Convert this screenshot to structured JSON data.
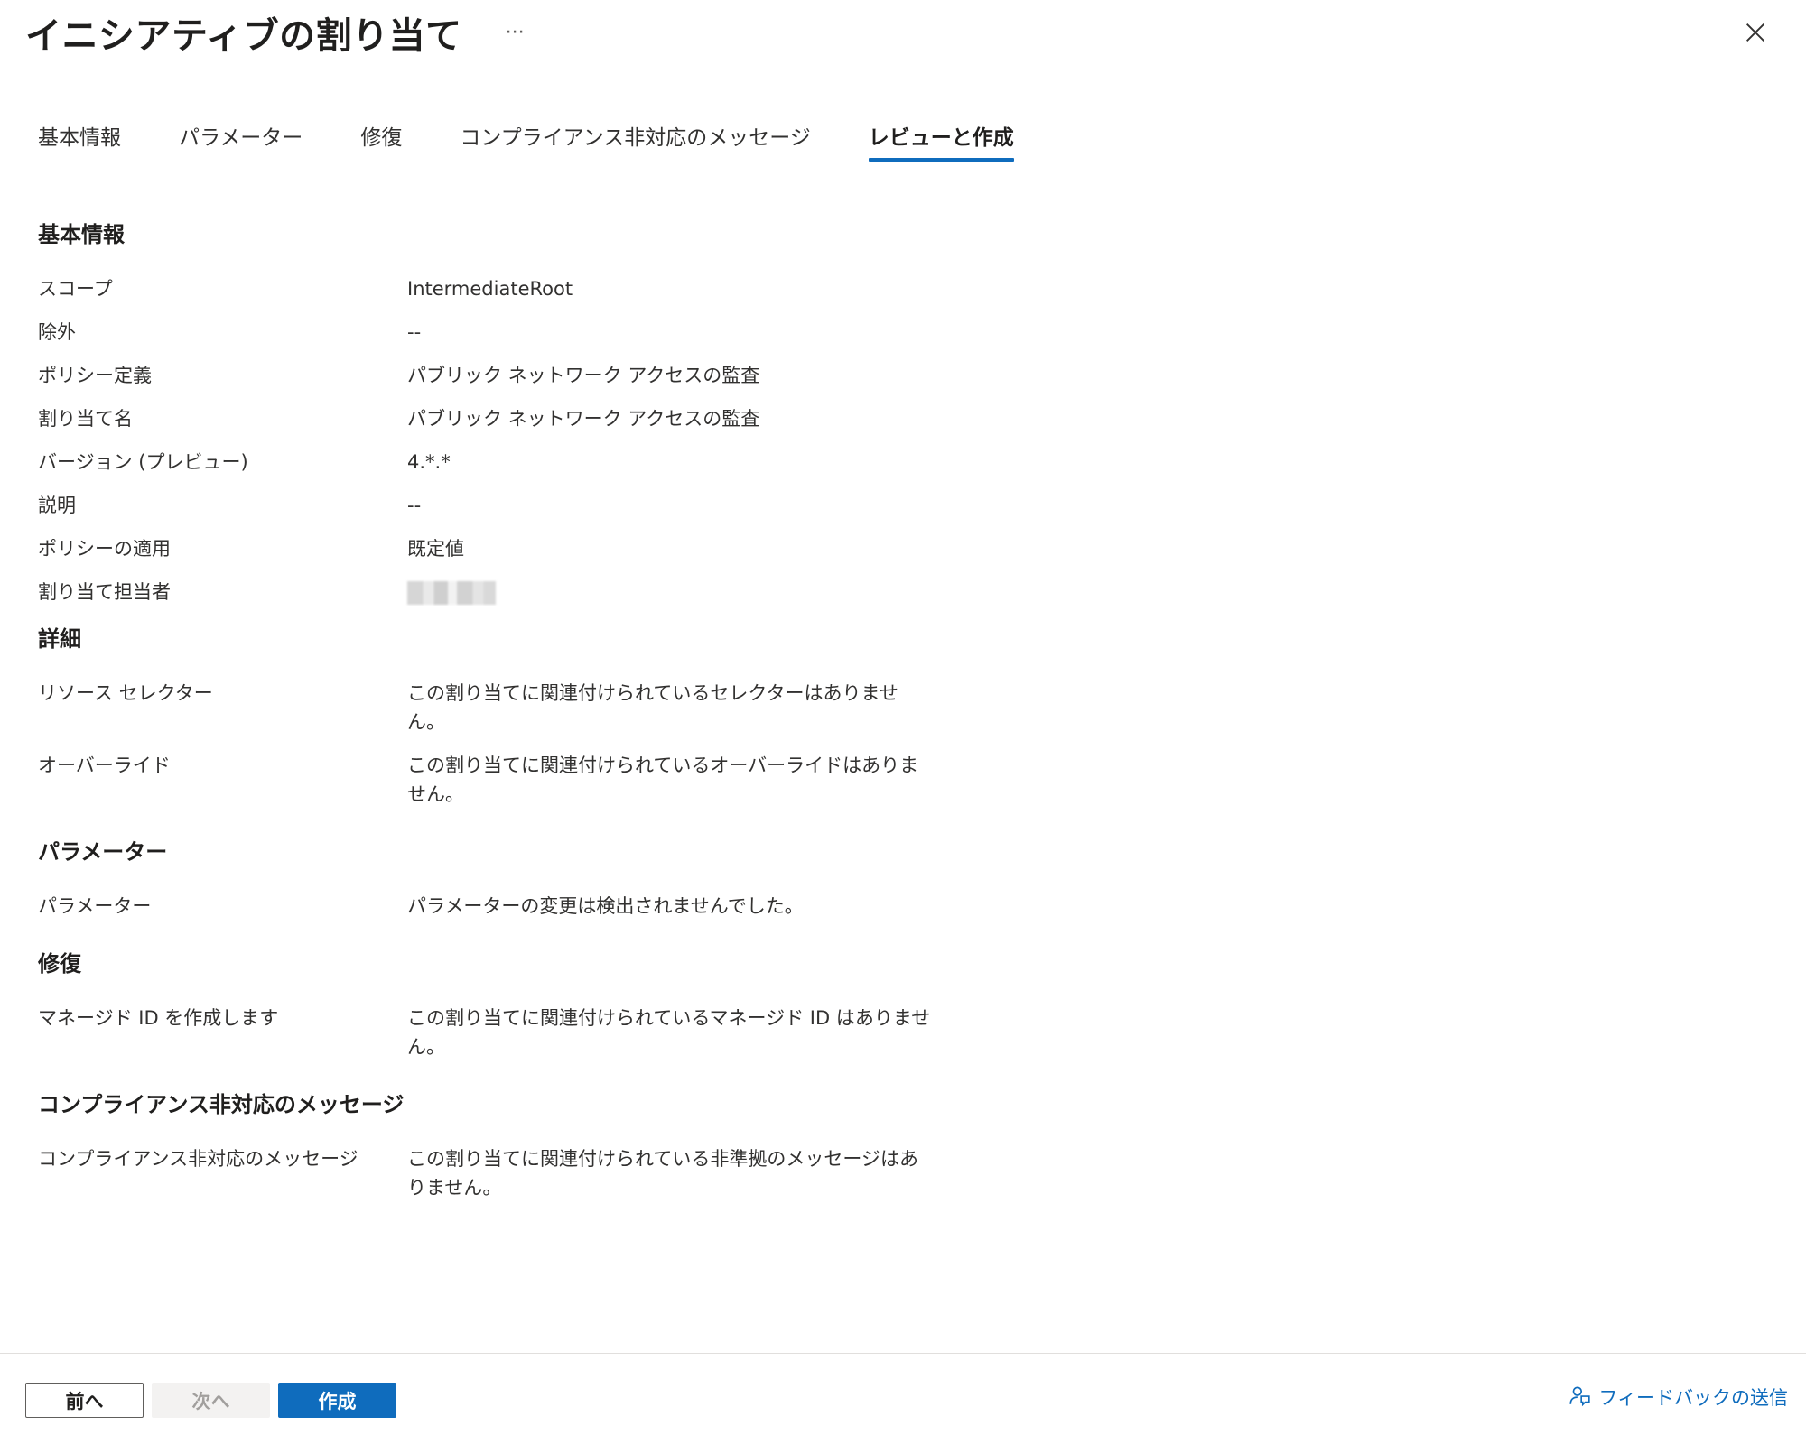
{
  "header": {
    "title": "イニシアティブの割り当て",
    "more_label": "···"
  },
  "tabs": [
    {
      "label": "基本情報",
      "active": false
    },
    {
      "label": "パラメーター",
      "active": false
    },
    {
      "label": "修復",
      "active": false
    },
    {
      "label": "コンプライアンス非対応のメッセージ",
      "active": false
    },
    {
      "label": "レビューと作成",
      "active": true
    }
  ],
  "sections": {
    "basics": {
      "title": "基本情報",
      "rows": [
        {
          "label": "スコープ",
          "value": "IntermediateRoot"
        },
        {
          "label": "除外",
          "value": "--"
        },
        {
          "label": "ポリシー定義",
          "value": "パブリック ネットワーク アクセスの監査"
        },
        {
          "label": "割り当て名",
          "value": "パブリック ネットワーク アクセスの監査"
        },
        {
          "label": "バージョン (プレビュー)",
          "value": "4.*.*"
        },
        {
          "label": "説明",
          "value": "--"
        },
        {
          "label": "ポリシーの適用",
          "value": "既定値"
        },
        {
          "label": "割り当て担当者",
          "value": ""
        }
      ]
    },
    "details": {
      "title": "詳細",
      "rows": [
        {
          "label": "リソース セレクター",
          "value": "この割り当てに関連付けられているセレクターはありません。"
        },
        {
          "label": "オーバーライド",
          "value": "この割り当てに関連付けられているオーバーライドはありません。"
        }
      ]
    },
    "parameters": {
      "title": "パラメーター",
      "rows": [
        {
          "label": "パラメーター",
          "value": "パラメーターの変更は検出されませんでした。"
        }
      ]
    },
    "remediation": {
      "title": "修復",
      "rows": [
        {
          "label": "マネージド ID を作成します",
          "value": "この割り当てに関連付けられているマネージド ID はありません。"
        }
      ]
    },
    "noncompliance": {
      "title": "コンプライアンス非対応のメッセージ",
      "rows": [
        {
          "label": "コンプライアンス非対応のメッセージ",
          "value": "この割り当てに関連付けられている非準拠のメッセージはありません。"
        }
      ]
    }
  },
  "footer": {
    "prev_label": "前へ",
    "next_label": "次へ",
    "create_label": "作成",
    "feedback_label": "フィードバックの送信"
  },
  "colors": {
    "accent": "#0f6cbd",
    "text": "#323130",
    "disabled_bg": "#f3f2f1",
    "disabled_text": "#a19f9d"
  },
  "icons": {
    "close": "close-icon",
    "feedback": "feedback-icon",
    "more": "more-icon"
  }
}
